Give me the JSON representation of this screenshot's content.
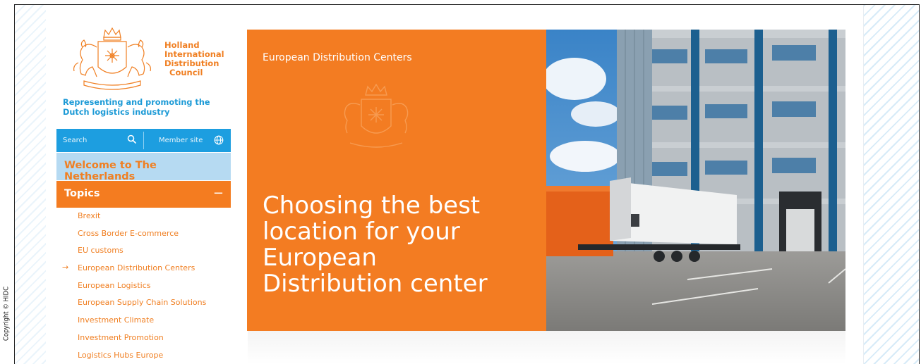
{
  "logo": {
    "lines": [
      "Holland",
      "International",
      "Distribution",
      "Council"
    ]
  },
  "tagline": {
    "line1": "Representing and promoting the",
    "line2": "Dutch logistics industry"
  },
  "search_bar": {
    "search_label": "Search",
    "member_label": "Member site"
  },
  "welcome": "Welcome to The Netherlands",
  "topics": {
    "heading": "Topics",
    "toggle": "−",
    "items": [
      {
        "label": "Brexit",
        "active": false
      },
      {
        "label": "Cross Border E-commerce",
        "active": false
      },
      {
        "label": "EU customs",
        "active": false
      },
      {
        "label": "European Distribution Centers",
        "active": true
      },
      {
        "label": "European Logistics",
        "active": false
      },
      {
        "label": "European Supply Chain Solutions",
        "active": false
      },
      {
        "label": "Investment Climate",
        "active": false
      },
      {
        "label": "Investment Promotion",
        "active": false
      },
      {
        "label": "Logistics Hubs Europe",
        "active": false
      }
    ],
    "active_marker": "→"
  },
  "hero": {
    "kicker": "European Distribution Centers",
    "title_lines": [
      "Choosing the best",
      "location for your",
      "European",
      "Distribution center"
    ]
  },
  "copyright": "Copyright © HIDC",
  "colors": {
    "orange": "#f37c22",
    "blue": "#1d9ee0",
    "light_blue": "#b6daf2",
    "tagline_blue": "#1c9ad6"
  }
}
